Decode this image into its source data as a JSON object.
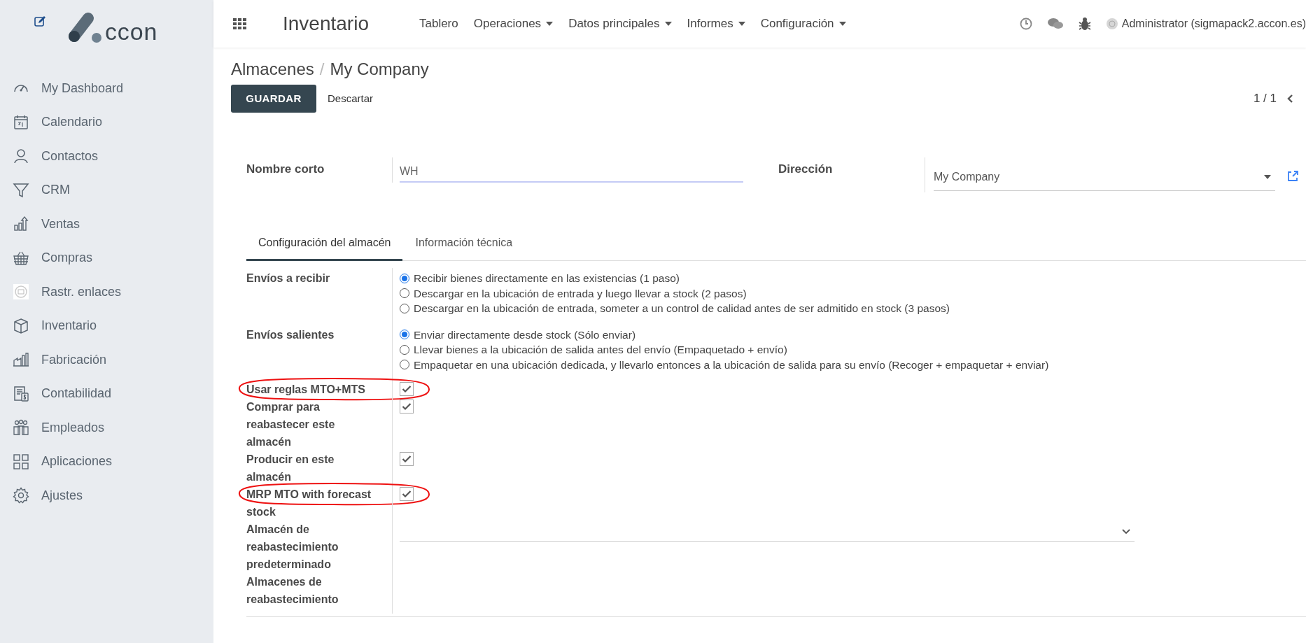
{
  "sidebar": {
    "logo_text": "ccon",
    "items": [
      {
        "label": "My Dashboard",
        "kind": "gauge"
      },
      {
        "label": "Calendario",
        "kind": "calendar"
      },
      {
        "label": "Contactos",
        "kind": "person"
      },
      {
        "label": "CRM",
        "kind": "funnel"
      },
      {
        "label": "Ventas",
        "kind": "chart"
      },
      {
        "label": "Compras",
        "kind": "basket"
      },
      {
        "label": "Rastr. enlaces",
        "kind": "image"
      },
      {
        "label": "Inventario",
        "kind": "box"
      },
      {
        "label": "Fabricación",
        "kind": "factory"
      },
      {
        "label": "Contabilidad",
        "kind": "ledger"
      },
      {
        "label": "Empleados",
        "kind": "people"
      },
      {
        "label": "Aplicaciones",
        "kind": "grid"
      },
      {
        "label": "Ajustes",
        "kind": "gear"
      }
    ]
  },
  "topbar": {
    "app_title": "Inventario",
    "menu": [
      {
        "label": "Tablero",
        "dropdown": false
      },
      {
        "label": "Operaciones",
        "dropdown": true
      },
      {
        "label": "Datos principales",
        "dropdown": true
      },
      {
        "label": "Informes",
        "dropdown": true
      },
      {
        "label": "Configuración",
        "dropdown": true
      }
    ],
    "user": "Administrator (sigmapack2.accon.es)"
  },
  "breadcrumb": [
    "Almacenes",
    "My Company"
  ],
  "breadcrumb_separator": "/",
  "buttons": {
    "save": "GUARDAR",
    "discard": "Descartar"
  },
  "pager": "1 / 1",
  "form": {
    "short_name": {
      "label": "Nombre corto",
      "value": "WH"
    },
    "address": {
      "label": "Dirección",
      "value": "My Company"
    },
    "tabs": [
      {
        "label": "Configuración del almacén",
        "selected": true
      },
      {
        "label": "Información técnica",
        "selected": false
      }
    ],
    "radio_groups": [
      {
        "label": "Envíos a recibir",
        "options": [
          {
            "label": "Recibir bienes directamente en las existencias (1 paso)",
            "selected": true
          },
          {
            "label": "Descargar en la ubicación de entrada y luego llevar a stock (2 pasos)",
            "selected": false
          },
          {
            "label": "Descargar en la ubicación de entrada, someter a un control de calidad antes de ser admitido en stock (3 pasos)",
            "selected": false
          }
        ]
      },
      {
        "label": "Envíos salientes",
        "options": [
          {
            "label": "Enviar directamente desde stock (Sólo enviar)",
            "selected": true
          },
          {
            "label": "Llevar bienes a la ubicación de salida antes del envío (Empaquetado + envío)",
            "selected": false
          },
          {
            "label": "Empaquetar en una ubicación dedicada, y llevarlo entonces a la ubicación de salida para su envío (Recoger + empaquetar + enviar)",
            "selected": false
          }
        ]
      }
    ],
    "checkboxes": [
      {
        "label": "Usar reglas MTO+MTS",
        "checked": true,
        "circled": true
      },
      {
        "label": "Comprar para reabastecer este almacén",
        "checked": true,
        "circled": false
      },
      {
        "label": "Producir en este almacén",
        "checked": true,
        "circled": false
      },
      {
        "label": "MRP MTO with forecast stock",
        "checked": true,
        "circled": true
      }
    ],
    "resupply_default": {
      "label": "Almacén de reabastecimiento predeterminado"
    },
    "resupply": {
      "label": "Almacenes de reabastecimiento"
    }
  }
}
